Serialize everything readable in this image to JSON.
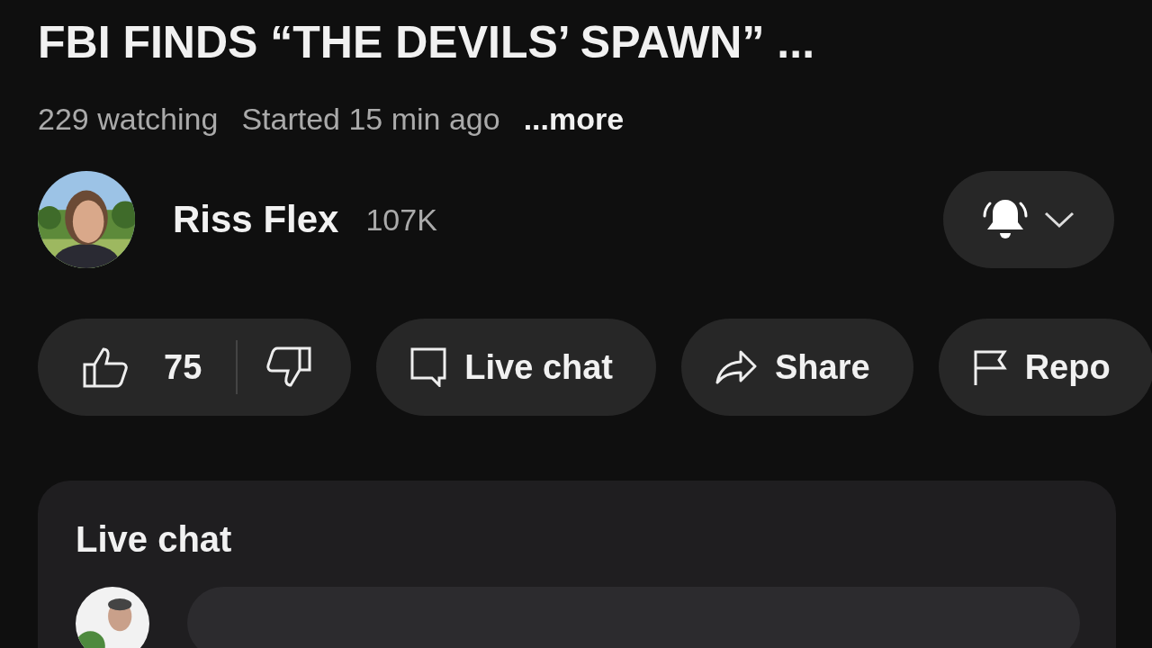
{
  "video": {
    "title": "FBI FINDS “THE DEVILS’ SPAWN” ...",
    "watching": "229 watching",
    "started": "Started 15 min ago",
    "more": "...more"
  },
  "channel": {
    "name": "Riss Flex",
    "subscribers": "107K"
  },
  "actions": [
    {
      "kind": "rating",
      "label": "75"
    },
    {
      "kind": "chat",
      "label": "Live chat"
    },
    {
      "kind": "share",
      "label": "Share"
    },
    {
      "kind": "report",
      "label": "Repo"
    }
  ],
  "live_chat": {
    "title": "Live chat"
  }
}
